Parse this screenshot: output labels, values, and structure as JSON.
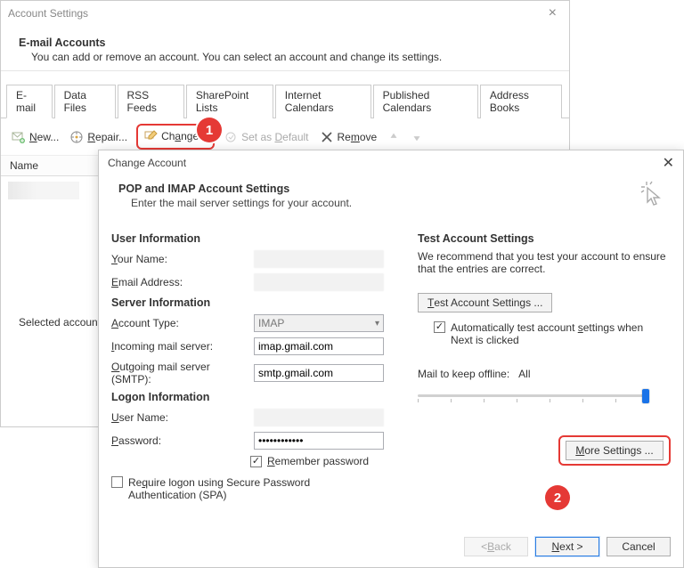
{
  "account_settings": {
    "title": "Account Settings",
    "heading": "E-mail Accounts",
    "sub": "You can add or remove an account. You can select an account and change its settings.",
    "tabs": [
      "E-mail",
      "Data Files",
      "RSS Feeds",
      "SharePoint Lists",
      "Internet Calendars",
      "Published Calendars",
      "Address Books"
    ],
    "toolbar": {
      "new": "New...",
      "repair": "Repair...",
      "change": "Change...",
      "set_default": "Set as Default",
      "remove": "Remove"
    },
    "col_name": "Name",
    "selected_caption": "Selected account de"
  },
  "steps": {
    "one": "1",
    "two": "2"
  },
  "change_account": {
    "title": "Change Account",
    "h1": "POP and IMAP Account Settings",
    "h_sub": "Enter the mail server settings for your account.",
    "left": {
      "user_info": "User Information",
      "your_name": "Your Name:",
      "email": "Email Address:",
      "server_info": "Server Information",
      "account_type": "Account Type:",
      "account_type_value": "IMAP",
      "incoming": "Incoming mail server:",
      "incoming_value": "imap.gmail.com",
      "outgoing": "Outgoing mail server (SMTP):",
      "outgoing_value": "smtp.gmail.com",
      "logon_info": "Logon Information",
      "user_name": "User Name:",
      "password": "Password:",
      "password_value": "************",
      "remember_password": "Remember password",
      "require_spa": "Require logon using Secure Password Authentication (SPA)"
    },
    "right": {
      "heading": "Test Account Settings",
      "desc": "We recommend that you test your account to ensure that the entries are correct.",
      "btn_test": "Test Account Settings ...",
      "auto_test": "Automatically test account settings when Next is clicked",
      "mail_keep_label": "Mail to keep offline:",
      "mail_keep_value": "All",
      "more_settings": "More Settings ..."
    },
    "footer": {
      "back": "< Back",
      "next": "Next >",
      "cancel": "Cancel"
    }
  }
}
